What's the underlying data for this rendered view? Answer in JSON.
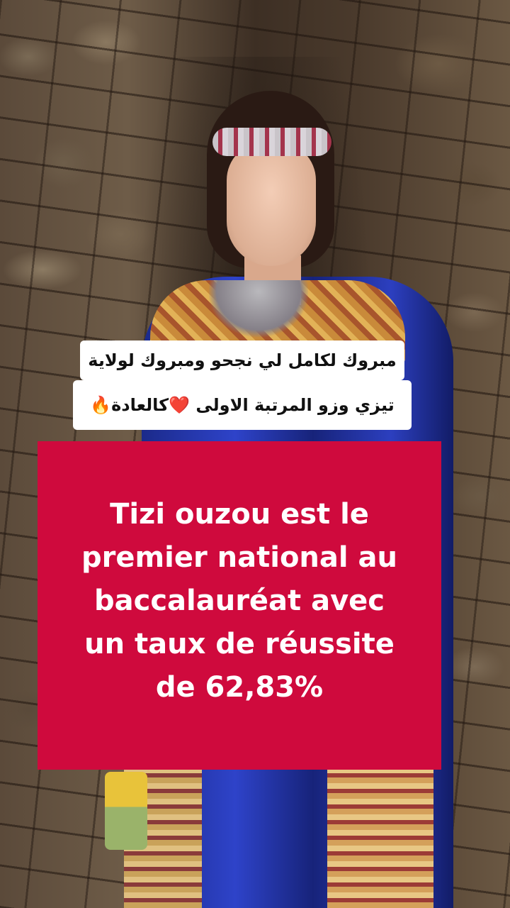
{
  "caption": {
    "line1": "مبروك لكامل لي نجحو ومبروك لولاية",
    "line2": "تيزي وزو المرتبة الاولى ❤️كالعادة🔥"
  },
  "banner": {
    "lines": [
      "Tizi ouzou est le",
      "premier national au",
      "baccalauréat avec",
      "un taux de réussite",
      "de 62,83%"
    ],
    "background_color": "#cf0a3d",
    "text_color": "#ffffff"
  }
}
